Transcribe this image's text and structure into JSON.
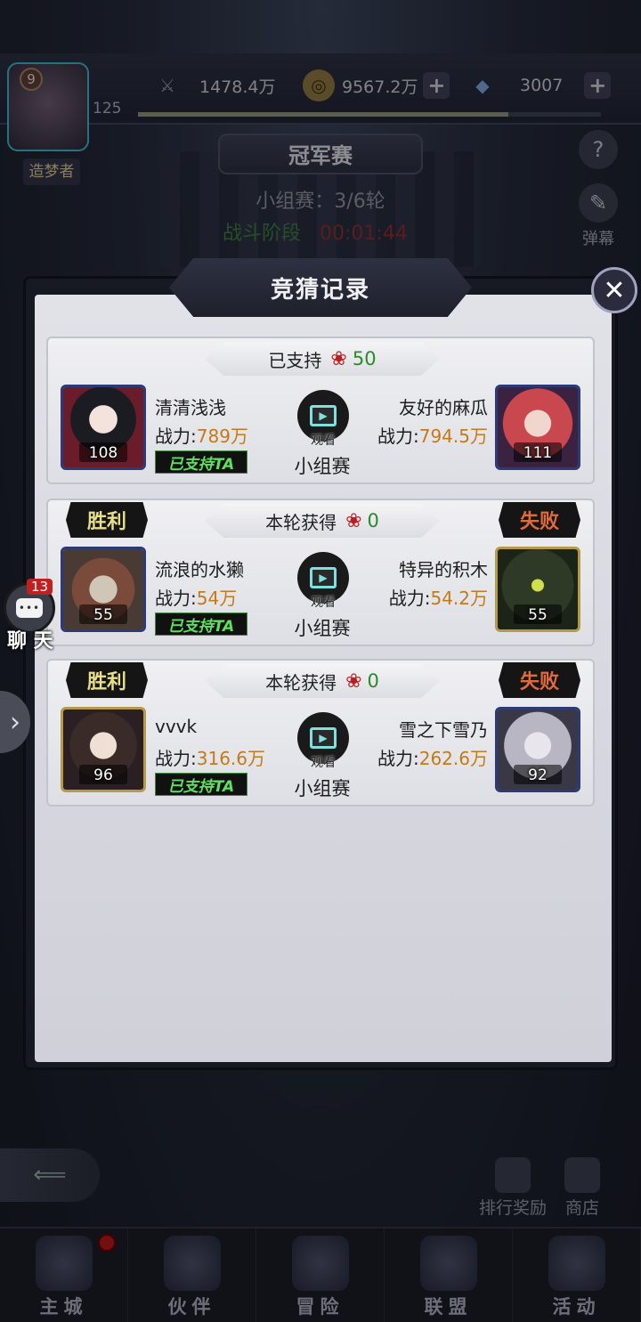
{
  "top": {
    "player_level": "9",
    "player_exp_level": "125",
    "rank_title": "造梦者",
    "resources": [
      {
        "icon": "sword-icon",
        "value": "1478.4万"
      },
      {
        "icon": "coin-icon",
        "value": "9567.2万"
      },
      {
        "icon": "diamond-icon",
        "value": "3007"
      }
    ],
    "xp_progress": 0.8
  },
  "event": {
    "title": "冠军赛",
    "stage": "小组赛：3/6轮",
    "phase_label": "战斗阶段",
    "phase_time": "00:01:44"
  },
  "side_buttons": {
    "help": "?",
    "danmaku_label": "弹幕"
  },
  "chat": {
    "count": "13",
    "label": "聊 天"
  },
  "modal": {
    "title": "竞猜记录",
    "close": "✕",
    "watch_label": "观看",
    "records": [
      {
        "header_label": "已支持",
        "roses": "50",
        "left_result": "",
        "right_result": "",
        "left": {
          "name": "清清浅浅",
          "power_label": "战力:",
          "power": "789万",
          "level": "108",
          "supported": "已支持TA"
        },
        "right": {
          "name": "友好的麻瓜",
          "power_label": "战力:",
          "power": "794.5万",
          "level": "111"
        },
        "match_type": "小组赛"
      },
      {
        "header_label": "本轮获得",
        "roses": "0",
        "left_result": "胜利",
        "right_result": "失败",
        "left": {
          "name": "流浪的水獭",
          "power_label": "战力:",
          "power": "54万",
          "level": "55",
          "supported": "已支持TA"
        },
        "right": {
          "name": "特异的积木",
          "power_label": "战力:",
          "power": "54.2万",
          "level": "55"
        },
        "match_type": "小组赛"
      },
      {
        "header_label": "本轮获得",
        "roses": "0",
        "left_result": "胜利",
        "right_result": "失败",
        "left": {
          "name": "vvvk",
          "power_label": "战力:",
          "power": "316.6万",
          "level": "96",
          "supported": "已支持TA"
        },
        "right": {
          "name": "雪之下雪乃",
          "power_label": "战力:",
          "power": "262.6万",
          "level": "92"
        },
        "match_type": "小组赛"
      }
    ]
  },
  "bottom_actions": {
    "ranking_reward": "排行奖励",
    "shop": "商店"
  },
  "nav": [
    {
      "label": "主城",
      "icon": "castle-icon"
    },
    {
      "label": "伙伴",
      "icon": "partner-icon"
    },
    {
      "label": "冒险",
      "icon": "compass-icon"
    },
    {
      "label": "联盟",
      "icon": "shield-icon"
    },
    {
      "label": "活动",
      "icon": "cards-icon"
    }
  ],
  "colors": {
    "power_value": "#c47a16",
    "rose": "#c01c1c",
    "support_green": "#5fe05f"
  }
}
